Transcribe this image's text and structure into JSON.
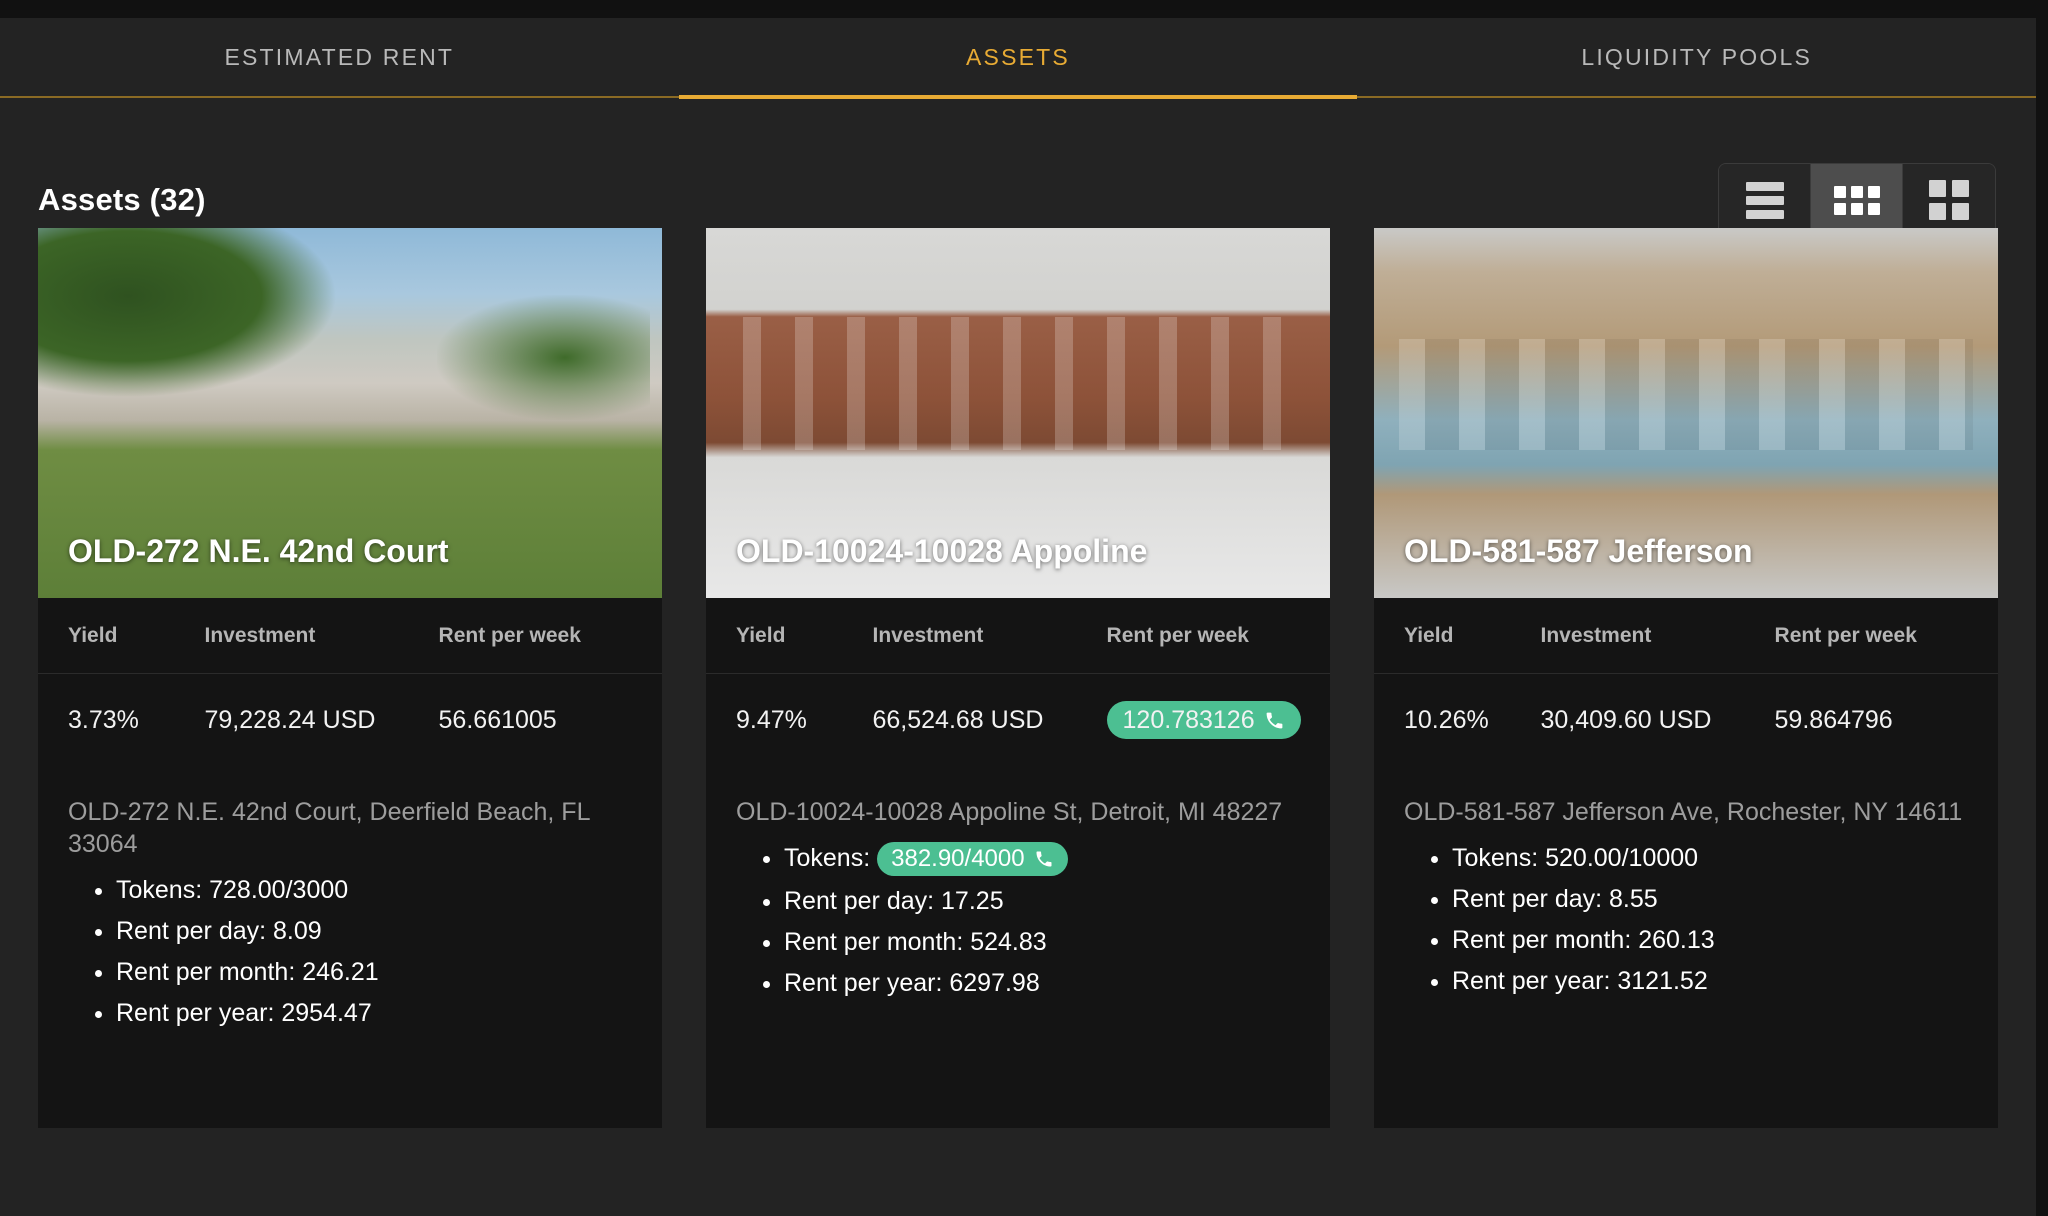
{
  "tabs": [
    {
      "label": "ESTIMATED RENT",
      "active": false
    },
    {
      "label": "ASSETS",
      "active": true
    },
    {
      "label": "LIQUIDITY POOLS",
      "active": false
    }
  ],
  "section": {
    "title": "Assets (32)"
  },
  "view_toggle": {
    "options": [
      "list-view",
      "grid-3-view",
      "grid-2-view"
    ],
    "selected": "grid-3-view"
  },
  "colors": {
    "accent": "#e8ab34",
    "page_bg": "#232323",
    "card_bg": "#141414",
    "pill_green": "#4cbf92",
    "muted_text": "#9d9d9d"
  },
  "table_headers": {
    "yield": "Yield",
    "investment": "Investment",
    "rent_per_week": "Rent per week"
  },
  "cards": [
    {
      "title": "OLD-272 N.E. 42nd Court",
      "photo": "ph1",
      "yield": "3.73%",
      "investment": "79,228.24 USD",
      "rent_per_week": "56.661005",
      "rent_per_week_highlighted": false,
      "address": "OLD-272 N.E. 42nd Court, Deerfield Beach, FL 33064",
      "tokens_label": "Tokens:",
      "tokens_value": "728.00/3000",
      "tokens_highlighted": false,
      "rent_per_day": "Rent per day: 8.09",
      "rent_per_month": "Rent per month: 246.21",
      "rent_per_year": "Rent per year: 2954.47"
    },
    {
      "title": "OLD-10024-10028 Appoline",
      "photo": "ph2",
      "yield": "9.47%",
      "investment": "66,524.68 USD",
      "rent_per_week": "120.783126",
      "rent_per_week_highlighted": true,
      "address": "OLD-10024-10028 Appoline St, Detroit, MI 48227",
      "tokens_label": "Tokens:",
      "tokens_value": "382.90/4000",
      "tokens_highlighted": true,
      "rent_per_day": "Rent per day: 17.25",
      "rent_per_month": "Rent per month: 524.83",
      "rent_per_year": "Rent per year: 6297.98"
    },
    {
      "title": "OLD-581-587 Jefferson",
      "photo": "ph3",
      "yield": "10.26%",
      "investment": "30,409.60 USD",
      "rent_per_week": "59.864796",
      "rent_per_week_highlighted": false,
      "address": "OLD-581-587 Jefferson Ave, Rochester, NY 14611",
      "tokens_label": "Tokens:",
      "tokens_value": "520.00/10000",
      "tokens_highlighted": false,
      "rent_per_day": "Rent per day: 8.55",
      "rent_per_month": "Rent per month: 260.13",
      "rent_per_year": "Rent per year: 3121.52"
    }
  ]
}
